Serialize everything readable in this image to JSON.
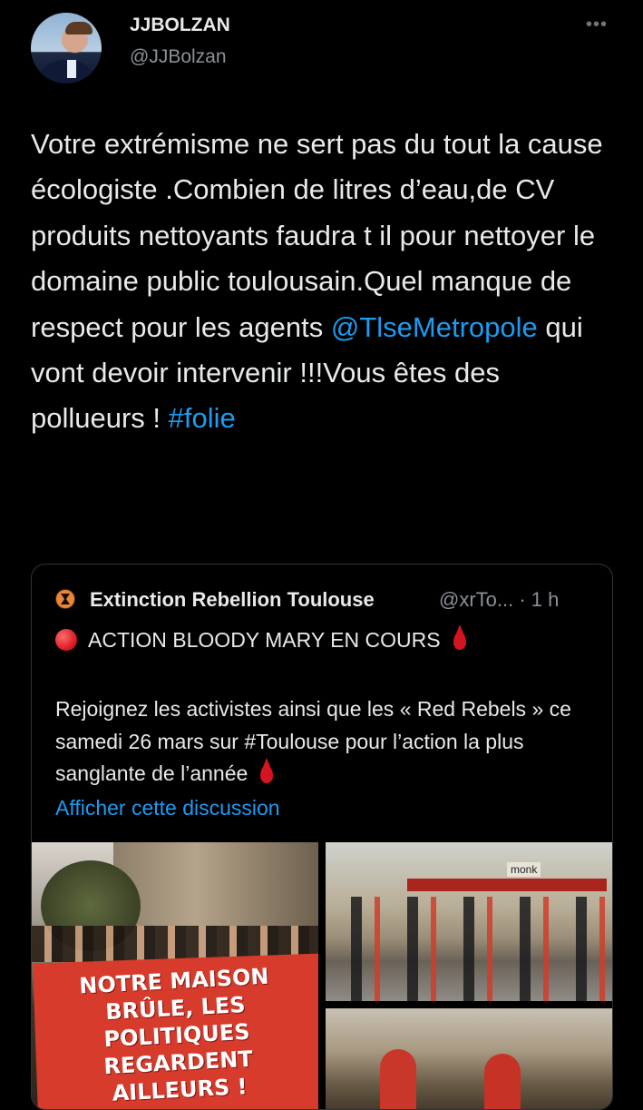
{
  "tweet": {
    "author_name": "JJBOLZAN",
    "author_handle": "@JJBolzan",
    "text_part1": "Votre extrémisme ne sert pas du tout la cause écologiste .Combien de litres d’eau,de CV produits nettoyants faudra t il pour nettoyer le domaine public toulousain.Quel manque de respect pour les agents ",
    "mention": "@TlseMetropole",
    "text_part2": " qui vont devoir intervenir !!!Vous êtes des pollueurs ! ",
    "hashtag": "#folie"
  },
  "quote": {
    "author_name": "Extinction Rebellion Toulouse",
    "author_handle": "@xrTo...",
    "time": "· 1 h",
    "headline": "ACTION BLOODY MARY EN COURS",
    "body": "Rejoignez les activistes ainsi que les « Red Rebels » ce samedi 26 mars sur #Toulouse pour l’action la plus sanglante de l’année",
    "show_thread": "Afficher cette discussion",
    "media": {
      "banner_text": "NOTRE MAISON BRÛLE, LES POLITIQUES REGARDENT AILLEURS !",
      "storefront_sign": "monk"
    }
  },
  "colors": {
    "background": "#000000",
    "text": "#e7e9ea",
    "secondary": "#8b9199",
    "link": "#1d9bf0",
    "border": "#2f3336"
  }
}
